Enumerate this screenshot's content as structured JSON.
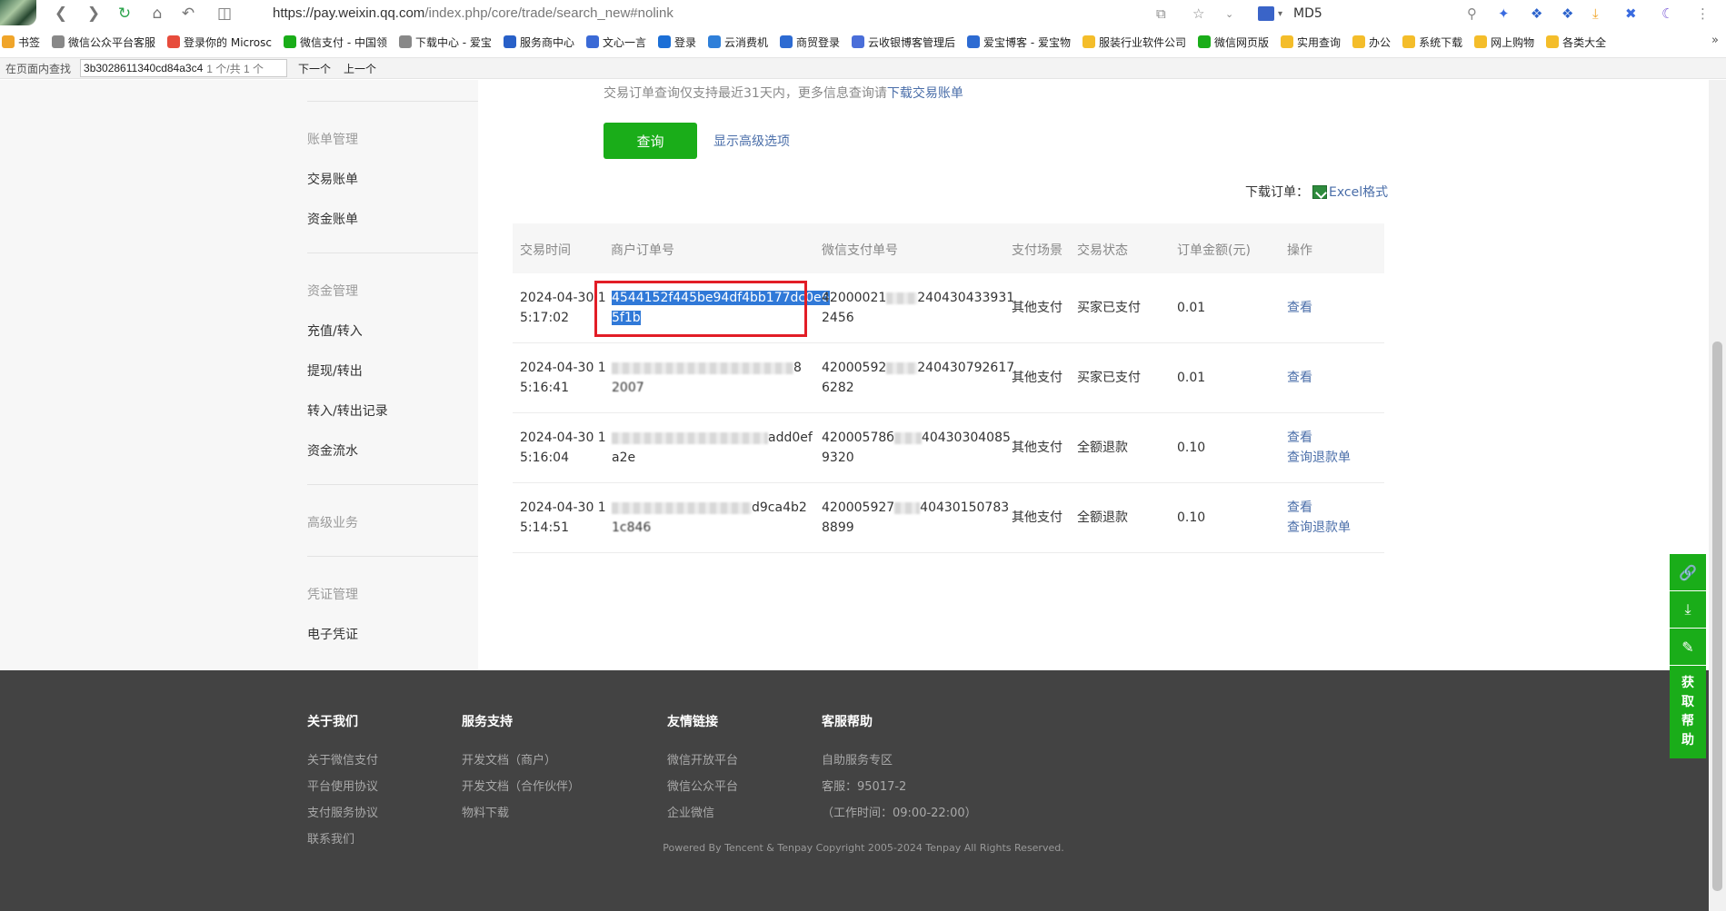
{
  "browser": {
    "url_main": "https://pay.weixin.qq.com",
    "url_path": "/index.php/core/trade/search_new#nolink",
    "md5_label": "MD5",
    "bookmarks": [
      {
        "label": "书签",
        "color": "#f0a52a"
      },
      {
        "label": "微信公众平台客服",
        "color": "#888"
      },
      {
        "label": "登录你的 Microsc",
        "color": "#e74c3c"
      },
      {
        "label": "微信支付 - 中国领",
        "color": "#1aad19"
      },
      {
        "label": "下载中心 - 爱宝",
        "color": "#888"
      },
      {
        "label": "服务商中心",
        "color": "#2860c8"
      },
      {
        "label": "文心一言",
        "color": "#3b6ad6"
      },
      {
        "label": "登录",
        "color": "#1c6fd6"
      },
      {
        "label": "云消费机",
        "color": "#2f7fd9"
      },
      {
        "label": "商贸登录",
        "color": "#2d6bd2"
      },
      {
        "label": "云收银博客管理后",
        "color": "#4a6ed9"
      },
      {
        "label": "爱宝博客 - 爱宝物",
        "color": "#2d6bd2"
      },
      {
        "label": "服装行业软件公司",
        "color": "#f4bd2a"
      },
      {
        "label": "微信网页版",
        "color": "#1aad19"
      },
      {
        "label": "实用查询",
        "color": "#f4bd2a"
      },
      {
        "label": "办公",
        "color": "#f4bd2a"
      },
      {
        "label": "系统下载",
        "color": "#f4bd2a"
      },
      {
        "label": "网上购物",
        "color": "#f4bd2a"
      },
      {
        "label": "各类大全",
        "color": "#f4bd2a"
      }
    ]
  },
  "findbar": {
    "label": "在页面内查找",
    "value": "3b3028611340cd84a3c4",
    "count": "1 个/共 1 个",
    "next": "下一个",
    "prev": "上一个"
  },
  "sidebar": {
    "groups": [
      {
        "head": "账单管理",
        "items": [
          "交易账单",
          "资金账单"
        ]
      },
      {
        "head": "资金管理",
        "items": [
          "充值/转入",
          "提现/转出",
          "转入/转出记录",
          "资金流水"
        ]
      },
      {
        "head": "高级业务",
        "items": []
      },
      {
        "head": "凭证管理",
        "items": [
          "电子凭证"
        ]
      }
    ]
  },
  "main": {
    "hint_text": "交易订单查询仅支持最近31天内，更多信息查询请",
    "hint_link": "下载交易账单",
    "query_button": "查询",
    "advanced_link": "显示高级选项",
    "download_label": "下载订单：",
    "download_excel": "Excel格式"
  },
  "table": {
    "headers": [
      "交易时间",
      "商户订单号",
      "微信支付单号",
      "支付场景",
      "交易状态",
      "订单金额(元)",
      "操作"
    ],
    "rows": [
      {
        "time1": "2024-04-30 1",
        "time2": "5:17:02",
        "merchant1": "4544152f445be94df4bb177dc0e6",
        "merchant2": "5f1b",
        "wx1a": "42000021",
        "wx1b": "240430433931",
        "wx2": "2456",
        "scene": "其他支付",
        "status": "买家已支付",
        "amount": "0.01",
        "actions": [
          "查看"
        ]
      },
      {
        "time1": "2024-04-30 1",
        "time2": "5:16:41",
        "merchant1b": "8",
        "merchant2": "2007",
        "wx1a": "42000592",
        "wx1b": "240430792617",
        "wx2": "6282",
        "scene": "其他支付",
        "status": "买家已支付",
        "amount": "0.01",
        "actions": [
          "查看"
        ]
      },
      {
        "time1": "2024-04-30 1",
        "time2": "5:16:04",
        "merchant1b": "add0ef",
        "merchant2": "a2e",
        "wx1a": "42000578б",
        "wx1b": "40430304085",
        "wx2": "9320",
        "scene": "其他支付",
        "status": "全额退款",
        "amount": "0.10",
        "actions": [
          "查看",
          "查询退款单"
        ]
      },
      {
        "time1": "2024-04-30 1",
        "time2": "5:14:51",
        "merchant1b": "d9ca4b2",
        "merchant2": "1c846",
        "wx1a": "420005927",
        "wx1b": "40430150783",
        "wx2": "8899",
        "scene": "其他支付",
        "status": "全额退款",
        "amount": "0.10",
        "actions": [
          "查看",
          "查询退款单"
        ]
      }
    ]
  },
  "floating": {
    "help_label": "获取帮助"
  },
  "footer": {
    "columns": [
      {
        "head": "关于我们",
        "links": [
          "关于微信支付",
          "平台使用协议",
          "支付服务协议",
          "联系我们"
        ]
      },
      {
        "head": "服务支持",
        "links": [
          "开发文档（商户）",
          "开发文档（合作伙伴）",
          "物料下载"
        ]
      },
      {
        "head": "友情链接",
        "links": [
          "微信开放平台",
          "微信公众平台",
          "企业微信"
        ]
      },
      {
        "head": "客服帮助",
        "links": [
          "自助服务专区",
          "客服：95017-2",
          "（工作时间：09:00-22:00）"
        ]
      }
    ],
    "copyright": "Powered By Tencent & Tenpay    Copyright 2005-2024 Tenpay All Rights Reserved."
  },
  "colors": {
    "brand_green": "#1aad19",
    "link_blue": "#4a6ea9",
    "highlight_red": "#e21d26",
    "selection_blue": "#3079d8"
  }
}
